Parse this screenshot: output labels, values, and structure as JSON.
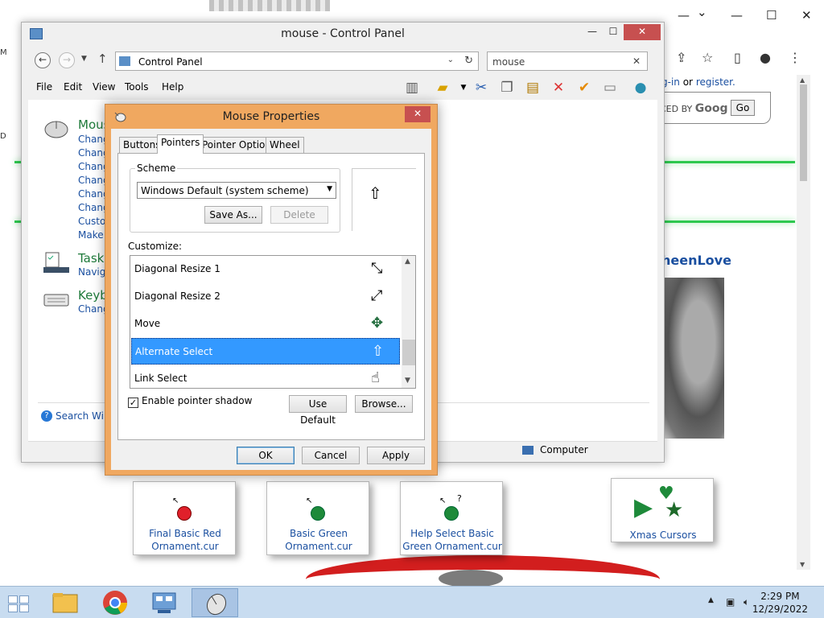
{
  "browser": {
    "login_text": "g-in",
    "login_or": "or",
    "register_text": "register.",
    "search_label": "CED BY",
    "search_brand": "Goog",
    "go_label": "Go",
    "site_name": "heenLove",
    "cursor_cards": [
      {
        "line1": "Final Basic Red",
        "line2": "Ornament.cur",
        "color": "#e0202a"
      },
      {
        "line1": "Basic Green",
        "line2": "Ornament.cur",
        "color": "#1e8a3a"
      },
      {
        "line1": "Help Select Basic",
        "line2": "Green Ornament.cur",
        "color": "#1e8a3a"
      },
      {
        "line1": "Xmas Cursors",
        "line2": "",
        "color": "#1e8a3a"
      }
    ]
  },
  "control_panel": {
    "title": "mouse - Control Panel",
    "address": "Control Panel",
    "search_value": "mouse",
    "menu": [
      "File",
      "Edit",
      "View",
      "Tools",
      "Help"
    ],
    "categories": [
      {
        "title": "Mous",
        "links": [
          "Chang",
          "Chang",
          "Chang",
          "Chang",
          "Chang",
          "Chang",
          "Custor",
          "Make i"
        ]
      },
      {
        "title": "Taskb",
        "links": [
          "Naviga"
        ]
      },
      {
        "title": "Keyb",
        "links": [
          "Chang"
        ]
      }
    ],
    "help_link": "Search Wind",
    "status_computer": "Computer",
    "controls": {
      "minimize": "—",
      "maximize": "☐",
      "close": "✕"
    }
  },
  "mouse_properties": {
    "title": "Mouse Properties",
    "close": "✕",
    "tabs": [
      "Buttons",
      "Pointers",
      "Pointer Options",
      "Wheel"
    ],
    "active_tab": "Pointers",
    "scheme_label": "Scheme",
    "scheme_value": "Windows Default (system scheme)",
    "save_as": "Save As...",
    "delete": "Delete",
    "customize_label": "Customize:",
    "pointers": [
      {
        "name": "Diagonal Resize 1",
        "glyph": "⤡"
      },
      {
        "name": "Diagonal Resize 2",
        "glyph": "⤢"
      },
      {
        "name": "Move",
        "glyph": "✥"
      },
      {
        "name": "Alternate Select",
        "glyph": "⇧"
      },
      {
        "name": "Link Select",
        "glyph": "☝"
      }
    ],
    "selected_index": 3,
    "preview_glyph": "⇧",
    "enable_shadow": "Enable pointer shadow",
    "use_default": "Use Default",
    "browse": "Browse...",
    "ok": "OK",
    "cancel": "Cancel",
    "apply": "Apply"
  },
  "taskbar": {
    "time": "2:29 PM",
    "date": "12/29/2022"
  },
  "colors": {
    "accent_green": "#2ec84f",
    "link_blue": "#1a4fa0",
    "dialog_frame": "#f0a860",
    "selection": "#3399ff",
    "close_red": "#c75050"
  }
}
